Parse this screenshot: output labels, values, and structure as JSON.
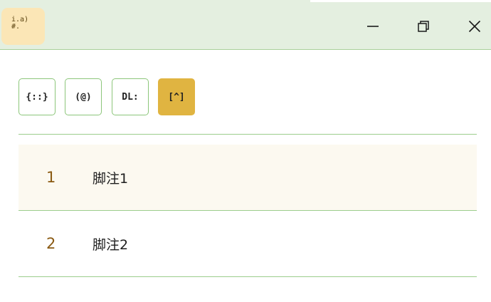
{
  "titlebar": {
    "app_icon_glyph": "i.a)\n#.",
    "icons": {
      "app": "numbered-list-icon",
      "minimize": "minimize-icon",
      "maximize": "maximize-icon",
      "close": "close-icon"
    },
    "background": "#e4efe0"
  },
  "toolbar": {
    "buttons": [
      {
        "label": "{::}",
        "active": false
      },
      {
        "label": "(@)",
        "active": false
      },
      {
        "label": "DL:",
        "active": false
      },
      {
        "label": "[^]",
        "active": true
      }
    ],
    "accent_color": "#e0b441",
    "border_color": "#8cc67a"
  },
  "list": {
    "items": [
      {
        "number": "1",
        "text": "脚注1",
        "highlighted": true
      },
      {
        "number": "2",
        "text": "脚注2",
        "highlighted": false
      }
    ],
    "number_color": "#8a5a12",
    "highlight_color": "#fcf9f0"
  }
}
